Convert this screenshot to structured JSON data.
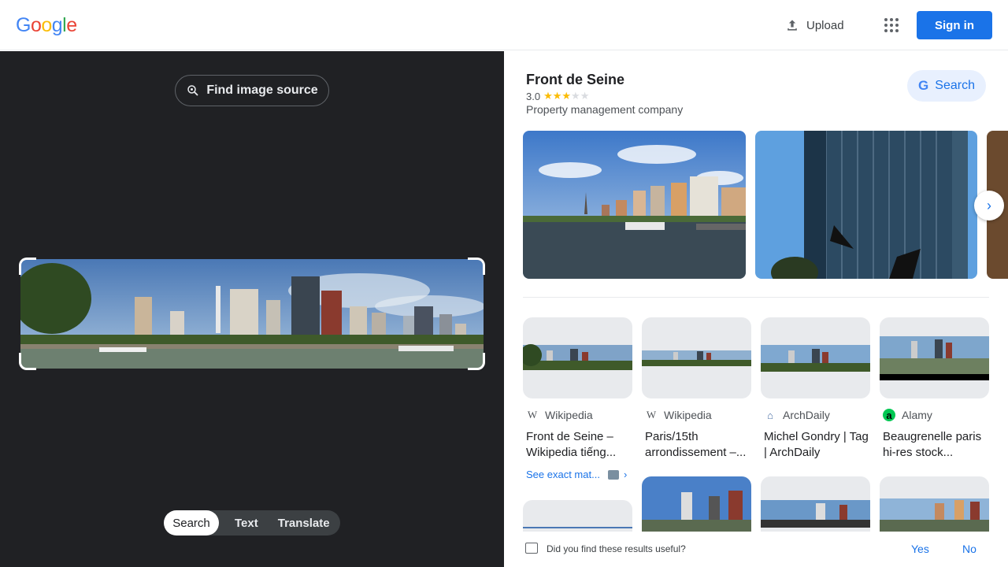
{
  "header": {
    "logo": [
      "G",
      "o",
      "o",
      "g",
      "l",
      "e"
    ],
    "logo_colors": [
      "#4285F4",
      "#EA4335",
      "#FBBC05",
      "#4285F4",
      "#34A853",
      "#EA4335"
    ],
    "upload_label": "Upload",
    "apps_icon": "apps-grid-icon",
    "signin_label": "Sign in",
    "accent": "#1a73e8"
  },
  "left": {
    "find_source_label": "Find image source",
    "modes": [
      "Search",
      "Text",
      "Translate"
    ],
    "active_mode": "Search"
  },
  "knowledge_panel": {
    "title": "Front de Seine",
    "rating": "3.0",
    "stars_filled": 3,
    "stars_total": 5,
    "category": "Property management company",
    "search_label": "Search"
  },
  "results": [
    {
      "source": "Wikipedia",
      "source_icon": "wikipedia-icon",
      "title": "Front de Seine – Wikipedia tiếng..."
    },
    {
      "source": "Wikipedia",
      "source_icon": "wikipedia-icon",
      "title": "Paris/15th arrondissement –..."
    },
    {
      "source": "ArchDaily",
      "source_icon": "archdaily-icon",
      "title": "Michel Gondry | Tag | ArchDaily"
    },
    {
      "source": "Alamy",
      "source_icon": "alamy-icon",
      "title": "Beaugrenelle paris hi-res stock..."
    }
  ],
  "see_exact_label": "See exact mat...",
  "feedback": {
    "question": "Did you find these results useful?",
    "yes": "Yes",
    "no": "No"
  }
}
